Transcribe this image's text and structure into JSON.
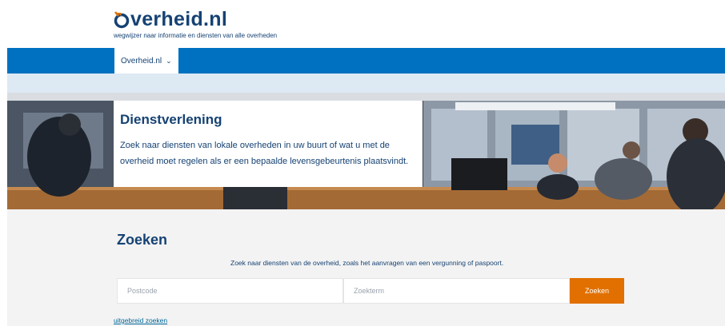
{
  "header": {
    "logo_text": "verheid",
    "logo_suffix": "nl",
    "logo_dot": ".",
    "tagline": "wegwijzer naar informatie en diensten van alle overheden"
  },
  "nav": {
    "items": [
      {
        "label": "Overheid.nl",
        "icon": "chevron-down-icon",
        "glyph": "⌄"
      }
    ]
  },
  "hero": {
    "title": "Dienstverlening",
    "description": "Zoek naar diensten van lokale overheden in uw buurt of wat u met de overheid moet regelen als er een bepaalde levensgebeurtenis plaatsvindt."
  },
  "search": {
    "title": "Zoeken",
    "hint": "Zoek naar diensten van de overheid, zoals het aanvragen van een vergunning of paspoort.",
    "postcode_placeholder": "Postcode",
    "term_placeholder": "Zoekterm",
    "button_label": "Zoeken",
    "advanced_link": "uitgebreid zoeken"
  },
  "colors": {
    "brand_blue": "#154273",
    "nav_blue": "#0071c0",
    "accent_orange": "#e17000"
  }
}
